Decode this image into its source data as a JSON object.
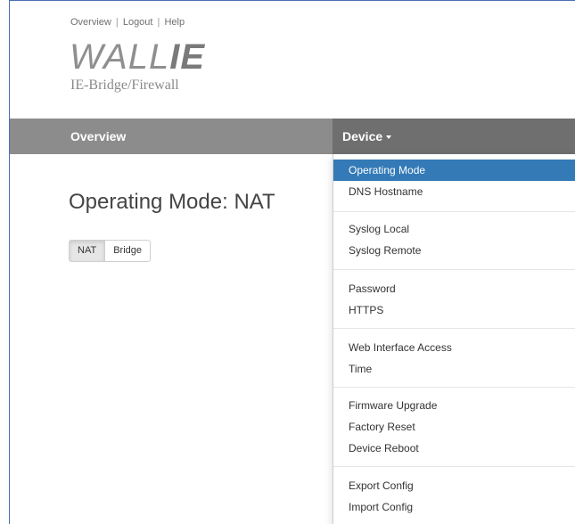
{
  "top_links": {
    "overview": "Overview",
    "sep1": "|",
    "logout": "Logout",
    "sep2": "|",
    "help": "Help"
  },
  "logo": {
    "wall": "WALL",
    "ie": "IE",
    "subtitle": "IE-Bridge/Firewall"
  },
  "navbar": {
    "overview": "Overview",
    "device": "Device"
  },
  "main": {
    "title": "Operating Mode: NAT",
    "mode_buttons": [
      {
        "label": "NAT",
        "active": true
      },
      {
        "label": "Bridge",
        "active": false
      }
    ]
  },
  "dropdown": {
    "items": [
      {
        "label": "Operating Mode",
        "active": true
      },
      {
        "label": "DNS Hostname"
      },
      {
        "label": "Syslog Local"
      },
      {
        "label": "Syslog Remote"
      },
      {
        "label": "Password"
      },
      {
        "label": "HTTPS"
      },
      {
        "label": "Web Interface Access"
      },
      {
        "label": "Time"
      },
      {
        "label": "Firmware Upgrade"
      },
      {
        "label": "Factory Reset"
      },
      {
        "label": "Device Reboot"
      },
      {
        "label": "Export Config"
      },
      {
        "label": "Import Config"
      }
    ]
  },
  "colors": {
    "navbar": "#8c8c8c",
    "navbar_active": "#6f6f6f",
    "dropdown_active": "#337ab7"
  }
}
